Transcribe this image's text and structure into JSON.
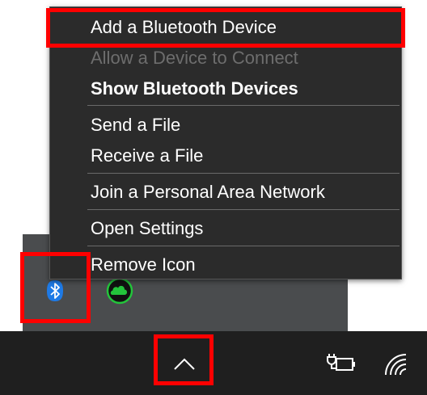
{
  "menu": {
    "items": [
      {
        "label": "Add a Bluetooth Device",
        "enabled": true,
        "bold": false
      },
      {
        "label": "Allow a Device to Connect",
        "enabled": false,
        "bold": false
      },
      {
        "label": "Show Bluetooth Devices",
        "enabled": true,
        "bold": true
      },
      {
        "label": "Send a File",
        "enabled": true,
        "bold": false
      },
      {
        "label": "Receive a File",
        "enabled": true,
        "bold": false
      },
      {
        "label": "Join a Personal Area Network",
        "enabled": true,
        "bold": false
      },
      {
        "label": "Open Settings",
        "enabled": true,
        "bold": false
      },
      {
        "label": "Remove Icon",
        "enabled": true,
        "bold": false
      }
    ]
  },
  "tray_icons": [
    "bluetooth-icon",
    "cloud-sync-icon"
  ],
  "taskbar_icons": [
    "chevron-up-icon",
    "power-plug-battery-icon",
    "wifi-icon"
  ],
  "colors": {
    "highlight": "#ff0000",
    "menu_bg": "#2b2b2b",
    "taskbar_bg": "#1f1f1f",
    "flyout_bg": "#4a4c4e",
    "bluetooth_blue": "#1e7ae6",
    "cloud_green": "#23c43b"
  }
}
